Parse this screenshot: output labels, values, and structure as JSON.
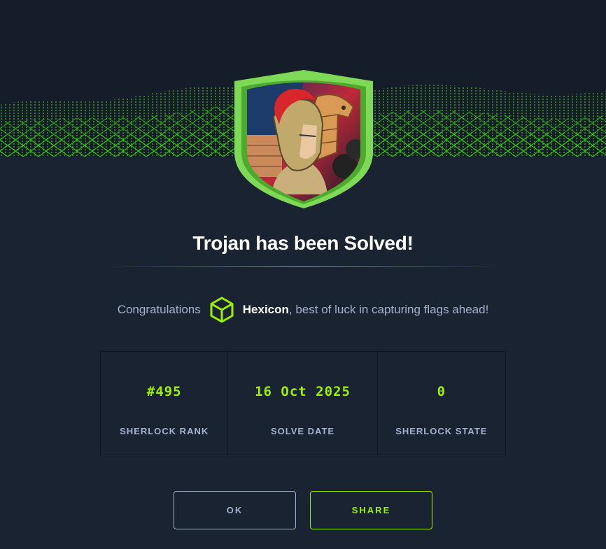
{
  "dialog": {
    "title": "Trojan has been Solved!",
    "congrats_prefix": "Congratulations",
    "username": "Hexicon",
    "congrats_suffix": ", best of luck in capturing flags ahead!"
  },
  "stats": [
    {
      "value": "#495",
      "label": "SHERLOCK RANK"
    },
    {
      "value": "16 Oct 2025",
      "label": "SOLVE DATE"
    },
    {
      "value": "0",
      "label": "SHERLOCK STATE"
    }
  ],
  "buttons": {
    "ok_label": "OK",
    "share_label": "SHARE"
  },
  "icons": {
    "banner": "green-wireframe-wave",
    "badge": "spartan-warrior-trojan-horse-shield",
    "user": "green-cube-icon"
  },
  "colors": {
    "background": "#1a2332",
    "accent": "#9fef00",
    "muted": "#a4b1cd",
    "text": "#ffffff"
  }
}
